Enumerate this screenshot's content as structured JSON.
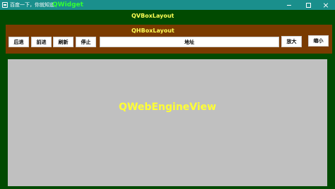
{
  "window": {
    "title": "百度一下，你就知道",
    "widget_label": "QWidget",
    "controls": {
      "minimize": "minimize-icon",
      "maximize": "maximize-icon",
      "close": "close-icon"
    }
  },
  "vbox": {
    "label": "QVBoxLayout"
  },
  "hbox": {
    "label": "QHBoxLayout",
    "buttons": {
      "back": "后退",
      "forward": "前进",
      "reload": "刷新",
      "stop": "停止",
      "zoom_in": "放大",
      "zoom_out": "缩小"
    },
    "address": {
      "value": "地址"
    }
  },
  "webview": {
    "label": "QWebEngineView"
  },
  "colors": {
    "titlebar": "#1a8f8c",
    "vbox_bg": "#014a01",
    "hbox_bg": "#7a3b00",
    "webview_bg": "#c0c0c0",
    "layout_label": "#ffff55",
    "widget_label": "#33ff33"
  }
}
